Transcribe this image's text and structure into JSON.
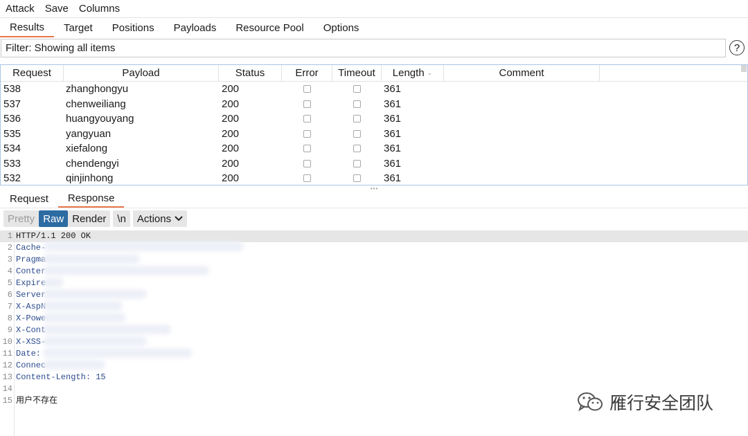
{
  "menu": [
    "Attack",
    "Save",
    "Columns"
  ],
  "top_tabs": [
    {
      "label": "Results",
      "active": true
    },
    {
      "label": "Target",
      "active": false
    },
    {
      "label": "Positions",
      "active": false
    },
    {
      "label": "Payloads",
      "active": false
    },
    {
      "label": "Resource Pool",
      "active": false
    },
    {
      "label": "Options",
      "active": false
    }
  ],
  "filter": {
    "text": "Filter: Showing all items",
    "help_label": "?"
  },
  "table": {
    "columns": [
      "Request",
      "Payload",
      "Status",
      "Error",
      "Timeout",
      "Length",
      "Comment"
    ],
    "sorted_column": "Length",
    "rows": [
      {
        "request": "538",
        "payload": "zhanghongyu",
        "status": "200",
        "error": false,
        "timeout": false,
        "length": "361",
        "comment": ""
      },
      {
        "request": "537",
        "payload": "chenweiliang",
        "status": "200",
        "error": false,
        "timeout": false,
        "length": "361",
        "comment": ""
      },
      {
        "request": "536",
        "payload": "huangyouyang",
        "status": "200",
        "error": false,
        "timeout": false,
        "length": "361",
        "comment": ""
      },
      {
        "request": "535",
        "payload": "yangyuan",
        "status": "200",
        "error": false,
        "timeout": false,
        "length": "361",
        "comment": ""
      },
      {
        "request": "534",
        "payload": "xiefalong",
        "status": "200",
        "error": false,
        "timeout": false,
        "length": "361",
        "comment": ""
      },
      {
        "request": "533",
        "payload": "chendengyi",
        "status": "200",
        "error": false,
        "timeout": false,
        "length": "361",
        "comment": ""
      },
      {
        "request": "532",
        "payload": "qinjinhong",
        "status": "200",
        "error": false,
        "timeout": false,
        "length": "361",
        "comment": ""
      }
    ]
  },
  "bottom_tabs": [
    {
      "label": "Request",
      "active": false
    },
    {
      "label": "Response",
      "active": true
    }
  ],
  "toolbar": {
    "pretty": "Pretty",
    "raw": "Raw",
    "render": "Render",
    "newline": "\\n",
    "actions": "Actions"
  },
  "response_lines": [
    {
      "n": "1",
      "text": "HTTP/1.1 200 OK"
    },
    {
      "n": "2",
      "text": "Cache-"
    },
    {
      "n": "3",
      "text": "Pragma"
    },
    {
      "n": "4",
      "text": "Conter"
    },
    {
      "n": "5",
      "text": "Expire"
    },
    {
      "n": "6",
      "text": "Server"
    },
    {
      "n": "7",
      "text": "X-AspN"
    },
    {
      "n": "8",
      "text": "X-Powe"
    },
    {
      "n": "9",
      "text": "X-Cont"
    },
    {
      "n": "10",
      "text": "X-XSS-"
    },
    {
      "n": "11",
      "text": "Date:"
    },
    {
      "n": "12",
      "text": "Connec"
    },
    {
      "n": "13",
      "text": "Content-Length: 15"
    },
    {
      "n": "14",
      "text": ""
    },
    {
      "n": "15",
      "text": "用户不存在"
    }
  ],
  "watermark": {
    "text": "雁行安全团队",
    "icon": "wechat-icon"
  }
}
